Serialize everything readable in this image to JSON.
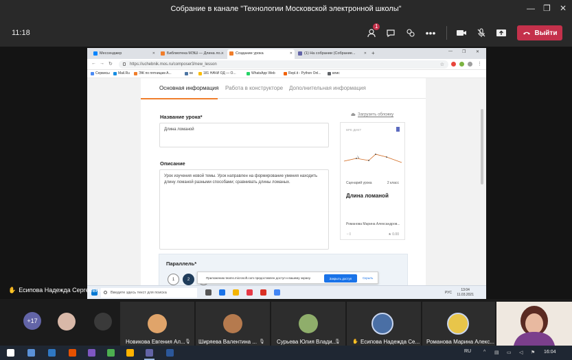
{
  "teams": {
    "title": "Собрание в канале \"Технологии Московской электронной школы\"",
    "timer": "11:18",
    "chat_badge": "1",
    "leave_label": "Выйти",
    "colors": {
      "leave": "#c4314b",
      "accent": "#6264a7"
    }
  },
  "browser": {
    "tabs": [
      {
        "label": "Мессенджер"
      },
      {
        "label": "Библиотека МЭШ — Длина ло..."
      },
      {
        "label": "Создание урока"
      },
      {
        "label": "(1) На собрании (Собрание..."
      }
    ],
    "url": "https://uchebnik.mos.ru/composer3/new_lesson",
    "bookmarks": [
      "Сервисы",
      "Mail.Ru",
      "ЭЖ по пятницам А...",
      "вк",
      "181 НАЧИ ОД — О...",
      "WhatsApp Web",
      "Repl.it - Python Onl...",
      "влис"
    ]
  },
  "lesson_page": {
    "tabs": [
      "Основная информация",
      "Работа в конструкторе",
      "Дополнительная информация"
    ],
    "name_label": "Название урока*",
    "name_value": "Длина ломаной",
    "desc_label": "Описание",
    "desc_value": "Урок изучения новой темы. Урок направлен на формирование умения находить длину ломаной разными способами; сравнивать длины ломаных.",
    "upload_label": "Загрузить обложку",
    "card": {
      "kicker": "ВРЕ ДИЕТ",
      "type": "Сценарий урока",
      "grade": "2 класс",
      "title": "Длина ломаной",
      "author": "Романова Марина Александров...",
      "views": "0",
      "rating": "0.00"
    },
    "parallel_label": "Параллель*",
    "parallel_items": [
      "1",
      "2",
      "3"
    ],
    "notification": {
      "text": "Приложению teams.microsoft.com предоставлен доступ к вашему экрану.",
      "share_button": "Закрыть доступ",
      "hide_button": "Скрыть"
    }
  },
  "inner_taskbar": {
    "search_placeholder": "Введите здесь текст для поиска",
    "lang": "РУС",
    "time": "13:04",
    "date": "11.03.2021"
  },
  "presenter": "Есипова Надежда Сергеевна",
  "participants": {
    "more_count": "+17",
    "tiles": [
      {
        "name": "Новикова Евгения Ал..."
      },
      {
        "name": "Ширяева Валентина ..."
      },
      {
        "name": "Сурьева Юлия Влади..."
      },
      {
        "name": "Есипова Надежда Се..."
      },
      {
        "name": "Романова Марина Алекс..."
      }
    ]
  },
  "taskbar": {
    "lang": "RU",
    "time": "16:04"
  }
}
